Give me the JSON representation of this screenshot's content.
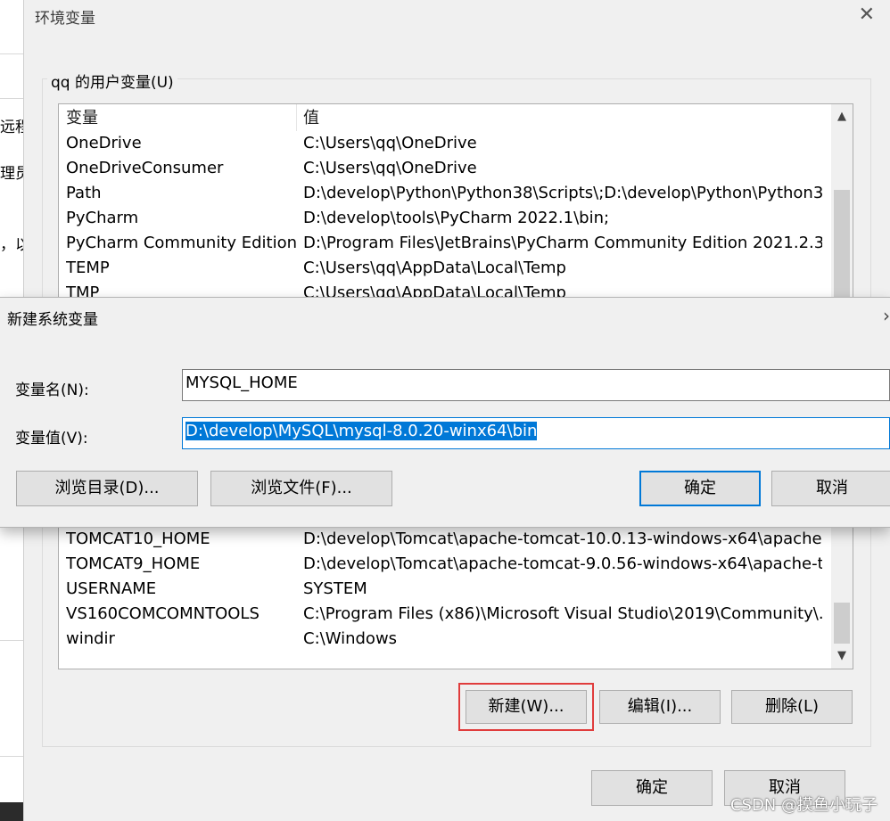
{
  "background": {
    "fragments": [
      "远程",
      "理员",
      "，以"
    ]
  },
  "env_dialog": {
    "title": "环境变量",
    "user_vars_label": "qq 的用户变量(U)",
    "columns": {
      "name": "变量",
      "value": "值"
    },
    "rows_top": [
      {
        "name": "OneDrive",
        "value": "C:\\Users\\qq\\OneDrive"
      },
      {
        "name": "OneDriveConsumer",
        "value": "C:\\Users\\qq\\OneDrive"
      },
      {
        "name": "Path",
        "value": "D:\\develop\\Python\\Python38\\Scripts\\;D:\\develop\\Python\\Python3..."
      },
      {
        "name": "PyCharm",
        "value": "D:\\develop\\tools\\PyCharm 2022.1\\bin;"
      },
      {
        "name": "PyCharm Community Edition",
        "value": "D:\\Program Files\\JetBrains\\PyCharm Community Edition 2021.2.3\\..."
      },
      {
        "name": "TEMP",
        "value": "C:\\Users\\qq\\AppData\\Local\\Temp"
      },
      {
        "name": "TMP",
        "value": "C:\\Users\\qq\\AppData\\Local\\Temp"
      }
    ],
    "rows_bottom": [
      {
        "name": "TOMCAT10_HOME",
        "value": "D:\\develop\\Tomcat\\apache-tomcat-10.0.13-windows-x64\\apache..."
      },
      {
        "name": "TOMCAT9_HOME",
        "value": "D:\\develop\\Tomcat\\apache-tomcat-9.0.56-windows-x64\\apache-t..."
      },
      {
        "name": "USERNAME",
        "value": "SYSTEM"
      },
      {
        "name": "VS160COMCOMNTOOLS",
        "value": "C:\\Program Files (x86)\\Microsoft Visual Studio\\2019\\Community\\..."
      },
      {
        "name": "windir",
        "value": "C:\\Windows"
      }
    ],
    "buttons": {
      "new": "新建(W)...",
      "edit": "编辑(I)...",
      "delete": "删除(L)"
    },
    "footer": {
      "ok": "确定",
      "cancel": "取消"
    }
  },
  "new_var_dialog": {
    "title": "新建系统变量",
    "name_label": "变量名(N):",
    "name_value": "MYSQL_HOME",
    "value_label": "变量值(V):",
    "value_value": "D:\\develop\\MySQL\\mysql-8.0.20-winx64\\bin",
    "browse_dir": "浏览目录(D)...",
    "browse_file": "浏览文件(F)...",
    "ok": "确定",
    "cancel": "取消"
  },
  "watermark": "CSDN @摸鱼小玩子",
  "colors": {
    "accent": "#0078d7",
    "highlight_box": "#e03c3c"
  }
}
